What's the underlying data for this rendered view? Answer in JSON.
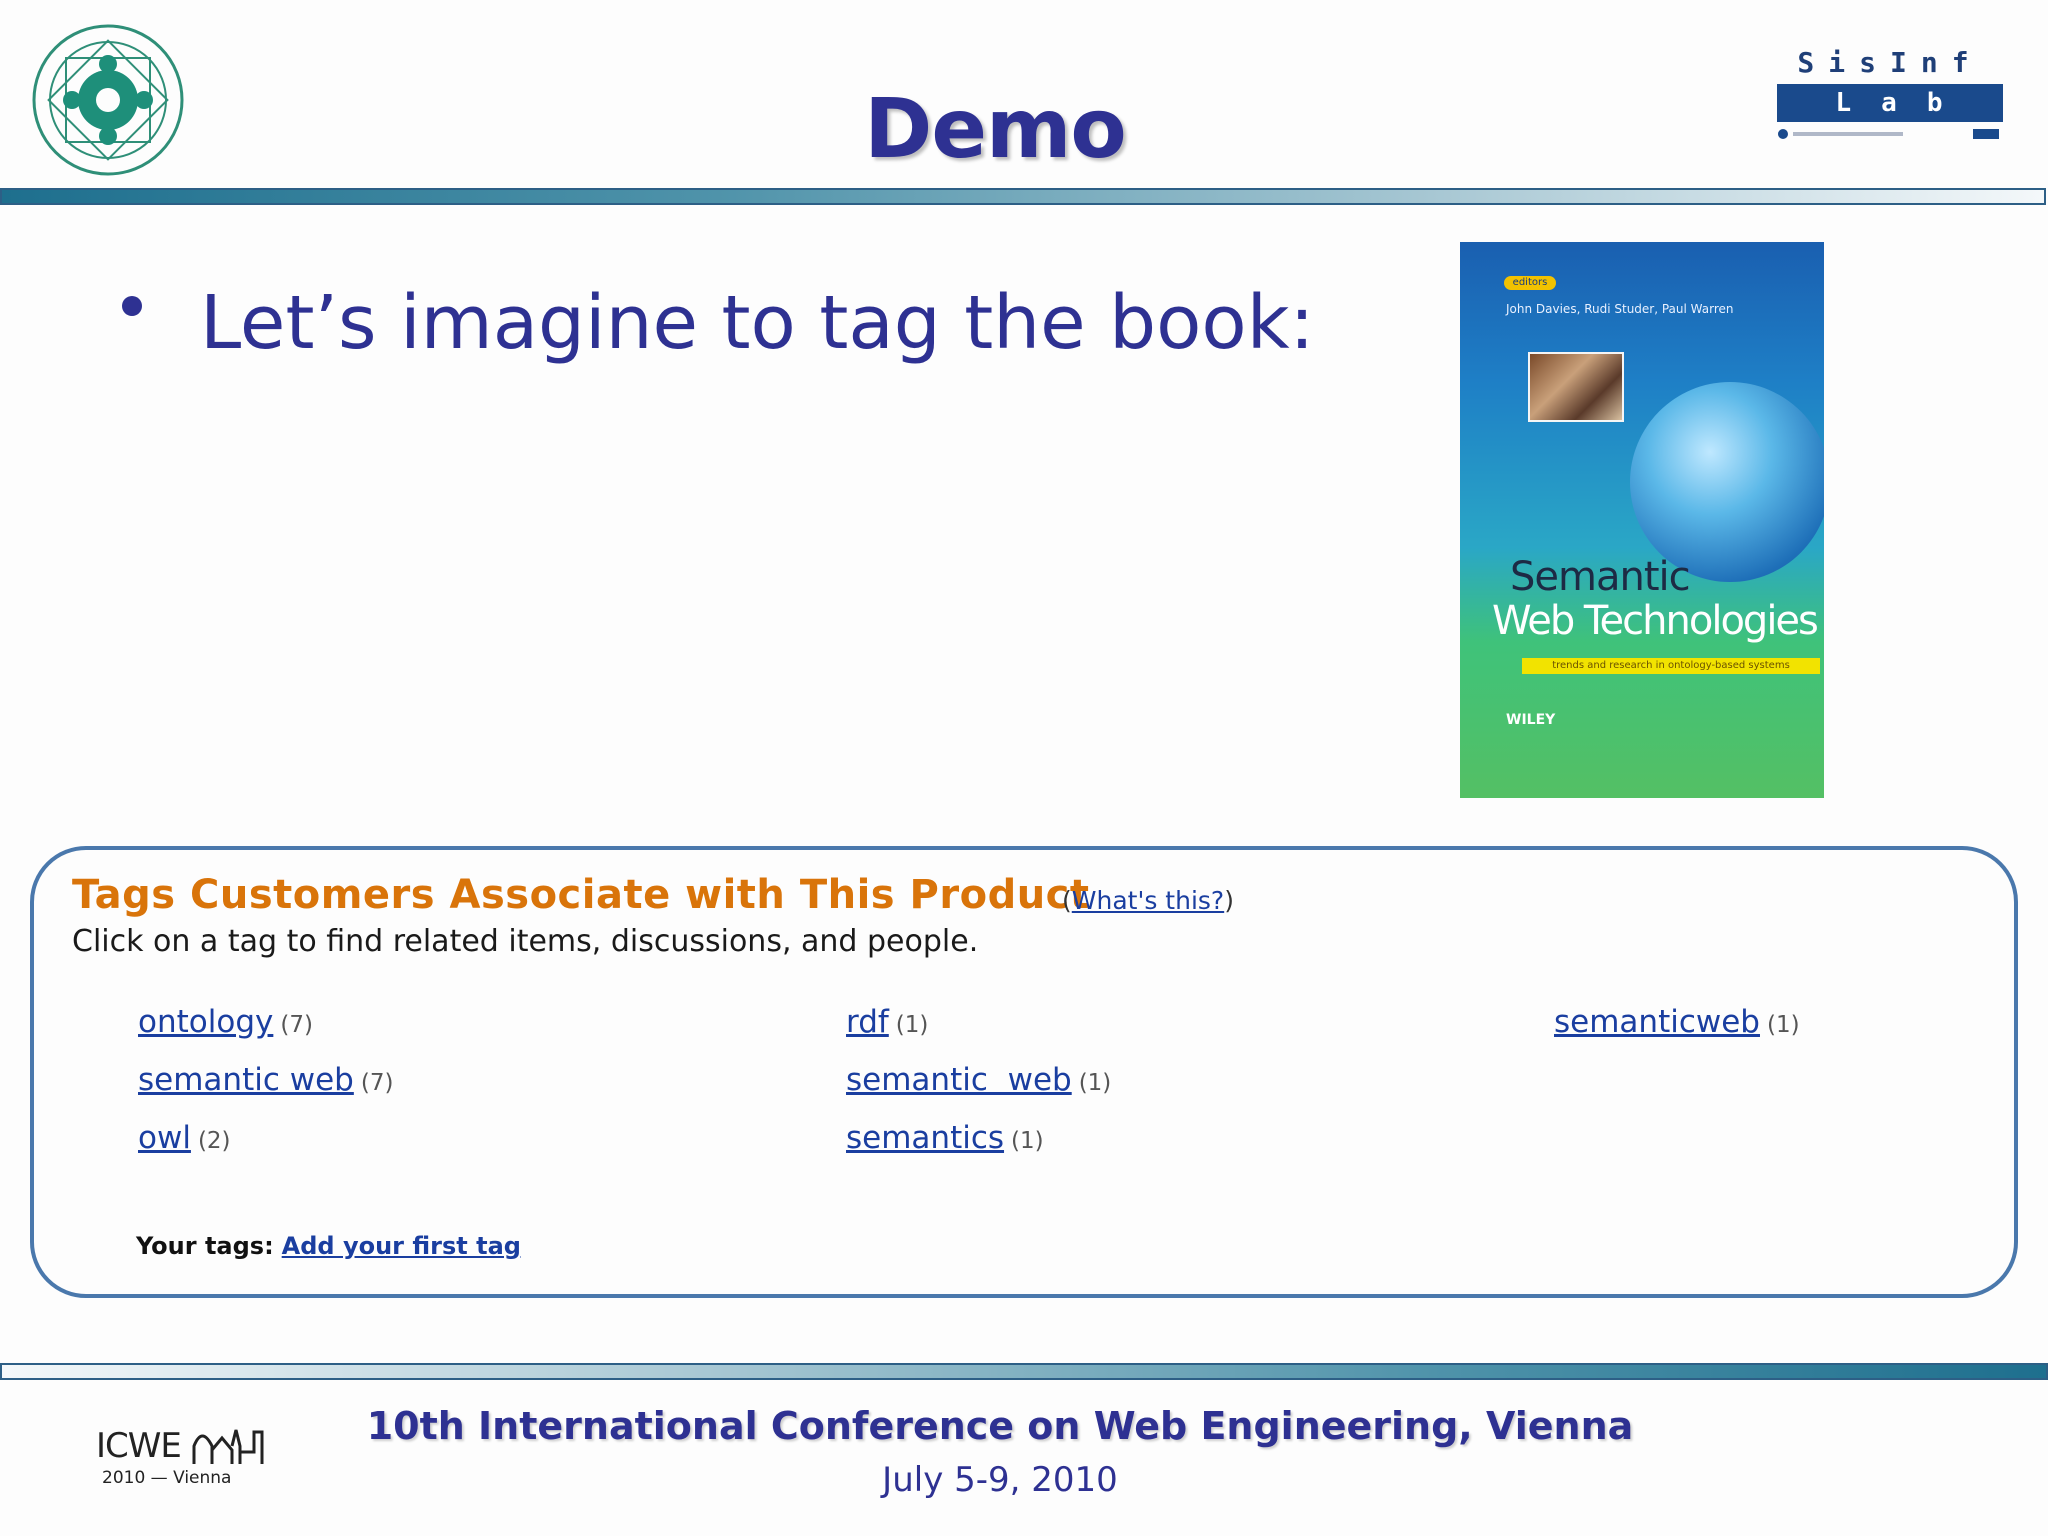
{
  "header": {
    "title": "Demo",
    "university_logo_icon": "politecnico-di-bari-seal-icon",
    "lab_logo": {
      "top_text": "SisInf",
      "box_text": "Lab",
      "icon": "sisinf-lab-logo-icon"
    }
  },
  "content": {
    "bullet_text": "Let’s imagine to tag the book:",
    "book_cover": {
      "editors_label": "editors",
      "authors": "John Davies, Rudi Studer, Paul Warren",
      "title_line1": "Semantic",
      "title_line2": "Web Technologies",
      "subtitle": "trends and research in ontology-based systems",
      "publisher": "WILEY"
    }
  },
  "tag_panel": {
    "heading": "Tags Customers Associate with This Product",
    "whats_this_open": "(",
    "whats_this_label": "What's this?",
    "whats_this_close": ")",
    "instruction": "Click on a tag to find related items, discussions, and people.",
    "tags": [
      {
        "name": "ontology",
        "count": "(7)"
      },
      {
        "name": "semantic web",
        "count": "(7)"
      },
      {
        "name": "owl",
        "count": "(2)"
      },
      {
        "name": "rdf",
        "count": "(1)"
      },
      {
        "name": "semantic  web",
        "count": "(1)"
      },
      {
        "name": "semantics",
        "count": "(1)"
      },
      {
        "name": "semanticweb",
        "count": "(1)"
      }
    ],
    "your_tags_label": "Your tags:",
    "add_first_tag_label": "Add your first tag"
  },
  "footer": {
    "conference_title": "10th International Conference on Web Engineering, Vienna",
    "dates": "July 5-9, 2010",
    "conference_logo_text": "ICWE",
    "conference_logo_sub": "2010 — Vienna",
    "conference_logo_icon": "icwe-2010-vienna-logo-icon"
  },
  "colors": {
    "title_blue": "#2e3192",
    "heading_orange": "#d9740a",
    "link_blue": "#1a3ea0",
    "panel_border": "#4a78ac",
    "bar_teal": "#1e6f8e"
  }
}
